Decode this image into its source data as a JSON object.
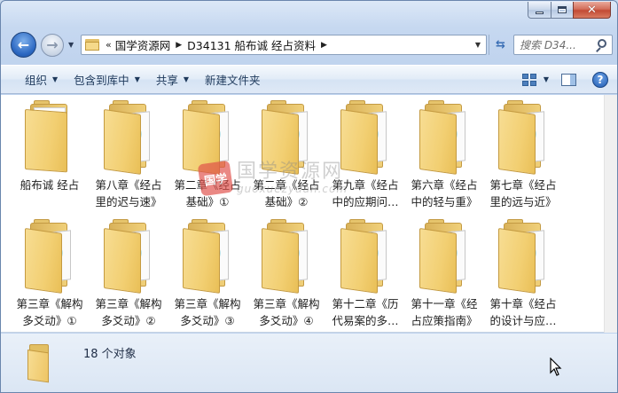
{
  "window": {
    "minimize_symbol": "–",
    "close_symbol": "✕"
  },
  "nav": {
    "back_icon": "back-arrow-icon",
    "forward_icon": "forward-arrow-icon",
    "breadcrumb_overflow": "«",
    "breadcrumbs": [
      "国学资源网",
      "D34131 船布诚 经占资料"
    ],
    "refresh_icon": "refresh-icon"
  },
  "search": {
    "placeholder": "搜索 D34..."
  },
  "toolbar": {
    "organize": "组织",
    "include_in_library": "包含到库中",
    "share": "共享",
    "new_folder": "新建文件夹",
    "help": "?"
  },
  "items": [
    {
      "label": "船布诚 经占",
      "type": "plain"
    },
    {
      "label": "第八章《经占里的迟与速》",
      "type": "docs"
    },
    {
      "label": "第二章《经占基础》①",
      "type": "docs"
    },
    {
      "label": "第二章《经占基础》②",
      "type": "docs"
    },
    {
      "label": "第九章《经占中的应期问…",
      "type": "docs"
    },
    {
      "label": "第六章《经占中的轻与重》",
      "type": "docs"
    },
    {
      "label": "第七章《经占里的远与近》",
      "type": "docs"
    },
    {
      "label": "第三章《解构多爻动》①",
      "type": "docs"
    },
    {
      "label": "第三章《解构多爻动》②",
      "type": "docs"
    },
    {
      "label": "第三章《解构多爻动》③",
      "type": "docs"
    },
    {
      "label": "第三章《解构多爻动》④",
      "type": "docs"
    },
    {
      "label": "第十二章《历代易案的多…",
      "type": "docs"
    },
    {
      "label": "第十一章《经占应策指南》",
      "type": "docs"
    },
    {
      "label": "第十章《经占的设计与应…",
      "type": "docs"
    }
  ],
  "watermark": {
    "seal": "国学",
    "cn": "国学资源网",
    "en": "guoxuezyuan.com"
  },
  "status": {
    "item_count": "18 个对象"
  },
  "colors": {
    "window_frame": "#c6d8f0",
    "close_button": "#c24a34",
    "folder": "#f2cf72",
    "toolbar_text": "#1e395b"
  }
}
